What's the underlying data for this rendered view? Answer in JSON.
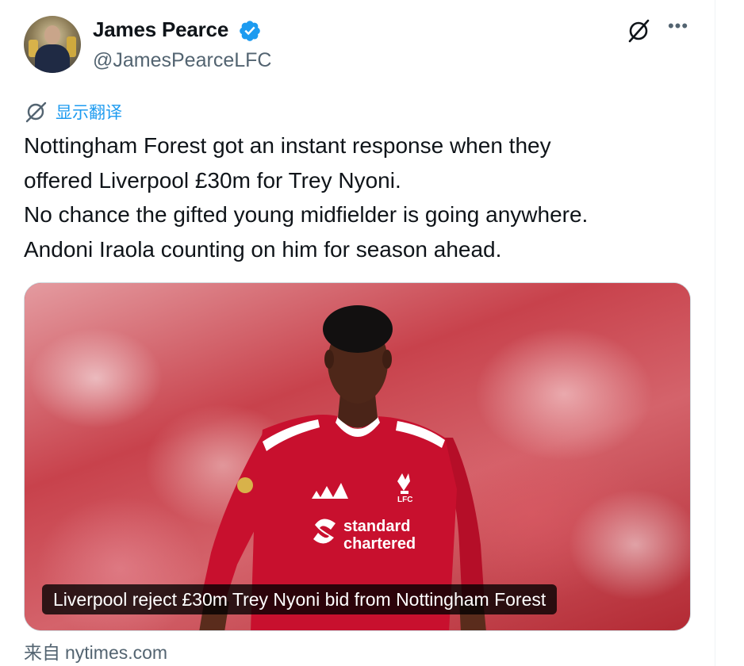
{
  "author": {
    "name": "James Pearce",
    "handle": "@JamesPearceLFC",
    "verified": true
  },
  "actions": {
    "grok": "grok-icon",
    "more": "•••"
  },
  "translate": {
    "label": "显示翻译"
  },
  "tweet": {
    "lines": [
      "Nottingham Forest got an instant response when they",
      "offered Liverpool £30m for Trey Nyoni.",
      "No chance the gifted young midfielder is going anywhere.",
      "Andoni Iraola counting on him for season ahead."
    ]
  },
  "card": {
    "caption": "Liverpool reject £30m Trey Nyoni bid from Nottingham Forest",
    "shirt_sponsor": [
      "standard",
      "chartered"
    ],
    "crest_text": "LFC"
  },
  "source": {
    "prefix": "来自",
    "domain": "nytimes.com"
  },
  "colors": {
    "accent": "#1d9bf0",
    "secondary_text": "#536471",
    "kit_red": "#c8102e"
  }
}
